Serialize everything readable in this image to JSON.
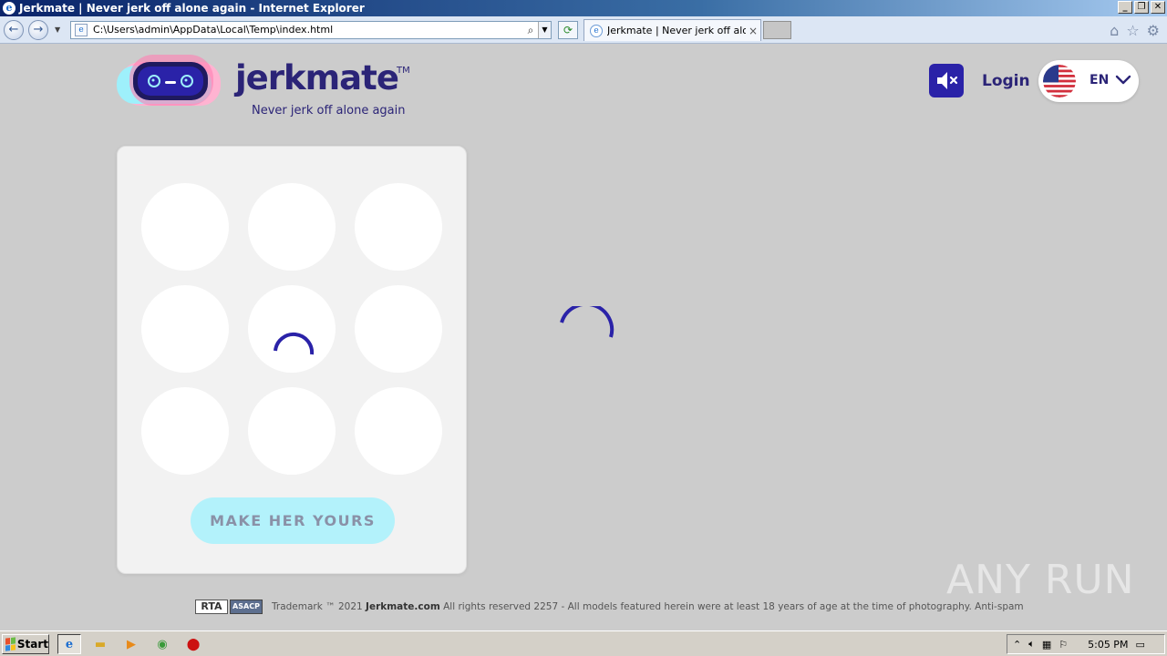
{
  "window": {
    "title": "Jerkmate | Never jerk off alone again - Internet Explorer",
    "controls": [
      "minimize",
      "restore",
      "close"
    ]
  },
  "browser": {
    "address": "C:\\Users\\admin\\AppData\\Local\\Temp\\index.html",
    "tab_title": "Jerkmate | Never jerk off alo...",
    "tab_close": "×",
    "icons": [
      "back-icon",
      "forward-icon",
      "search-icon",
      "refresh-icon",
      "home-icon",
      "star-icon",
      "gear-icon"
    ]
  },
  "header": {
    "brand": "jerkmate",
    "trademark": "TM",
    "tagline": "Never jerk off alone again",
    "login": "Login",
    "language": "EN"
  },
  "card": {
    "slots": 9,
    "cta": "MAKE HER YOURS"
  },
  "footer": {
    "badge_rta": "RTA",
    "badge_asacp": "ASACP",
    "prefix": "Trademark ™ 2021 ",
    "site": "Jerkmate.com",
    "suffix": " All rights reserved 2257 - All models featured herein were at least 18 years of age at the time of photography. Anti-spam"
  },
  "watermark": "ANY RUN",
  "taskbar": {
    "start": "Start",
    "clock": "5:05 PM"
  },
  "colors": {
    "brand_navy": "#2b2477",
    "brand_blue": "#2a22a8",
    "cta_bg": "#b3f2fb",
    "page_bg": "#cccccc"
  }
}
